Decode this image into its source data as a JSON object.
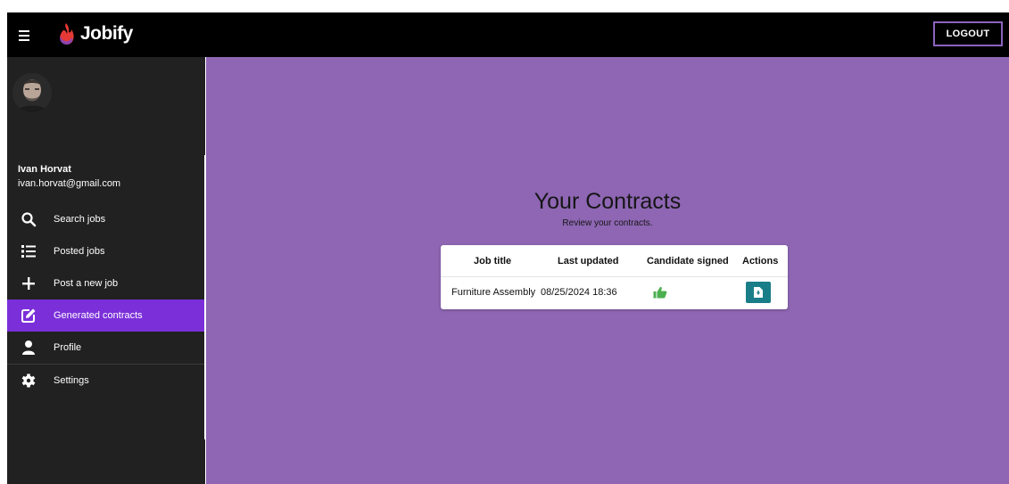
{
  "app": {
    "brand": "Jobify",
    "logout_label": "LOGOUT"
  },
  "user": {
    "name": "Ivan Horvat",
    "email": "ivan.horvat@gmail.com"
  },
  "nav": [
    {
      "label": "Search jobs",
      "icon": "search-icon"
    },
    {
      "label": "Posted jobs",
      "icon": "list-icon"
    },
    {
      "label": "Post a new job",
      "icon": "plus-icon"
    },
    {
      "label": "Generated contracts",
      "icon": "edit-icon",
      "active": true
    },
    {
      "label": "Profile",
      "icon": "person-icon"
    },
    {
      "label": "Settings",
      "icon": "gear-icon"
    }
  ],
  "main": {
    "title": "Your Contracts",
    "subtitle": "Review your contracts.",
    "table": {
      "columns": [
        "Job title",
        "Last updated",
        "Candidate signed",
        "Actions"
      ],
      "rows": [
        {
          "job_title": "Furniture Assembly",
          "last_updated": "08/25/2024 18:36",
          "candidate_signed_icon": "thumbs-up-icon",
          "action_icon": "download-file-icon"
        }
      ]
    }
  },
  "colors": {
    "topbar": "#000000",
    "sidebar": "#212121",
    "active_nav": "#7b2fd9",
    "main_bg": "#8e66b3",
    "action_button": "#1a7e88",
    "thumb_up": "#4caf50",
    "logout_border": "#8b63c0"
  }
}
